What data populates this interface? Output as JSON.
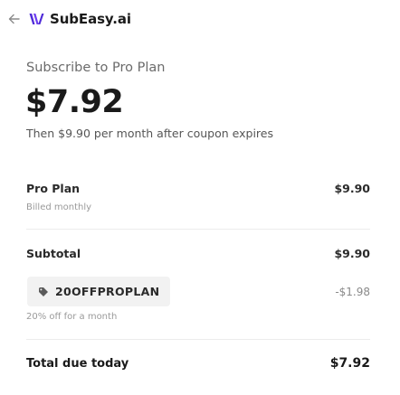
{
  "header": {
    "brand": "SubEasy.ai",
    "back_icon": "arrow-left-icon",
    "logo_icon": "subeasy-logo"
  },
  "summary": {
    "title": "Subscribe to Pro Plan",
    "price": "$7.92",
    "note": "Then $9.90 per month after coupon expires"
  },
  "line_items": {
    "plan": {
      "label": "Pro Plan",
      "sub": "Billed monthly",
      "amount": "$9.90"
    },
    "subtotal": {
      "label": "Subtotal",
      "amount": "$9.90"
    },
    "coupon": {
      "code": "20OFFPROPLAN",
      "icon": "tag-icon",
      "description": "20% off for a month",
      "amount": "-$1.98"
    },
    "total": {
      "label": "Total due today",
      "amount": "$7.92"
    }
  },
  "colors": {
    "brand_purple": "#5b2bd8",
    "text_primary": "#1a1a1a",
    "text_muted": "#6b6b6b",
    "coupon_bg": "#f2f2f2"
  }
}
